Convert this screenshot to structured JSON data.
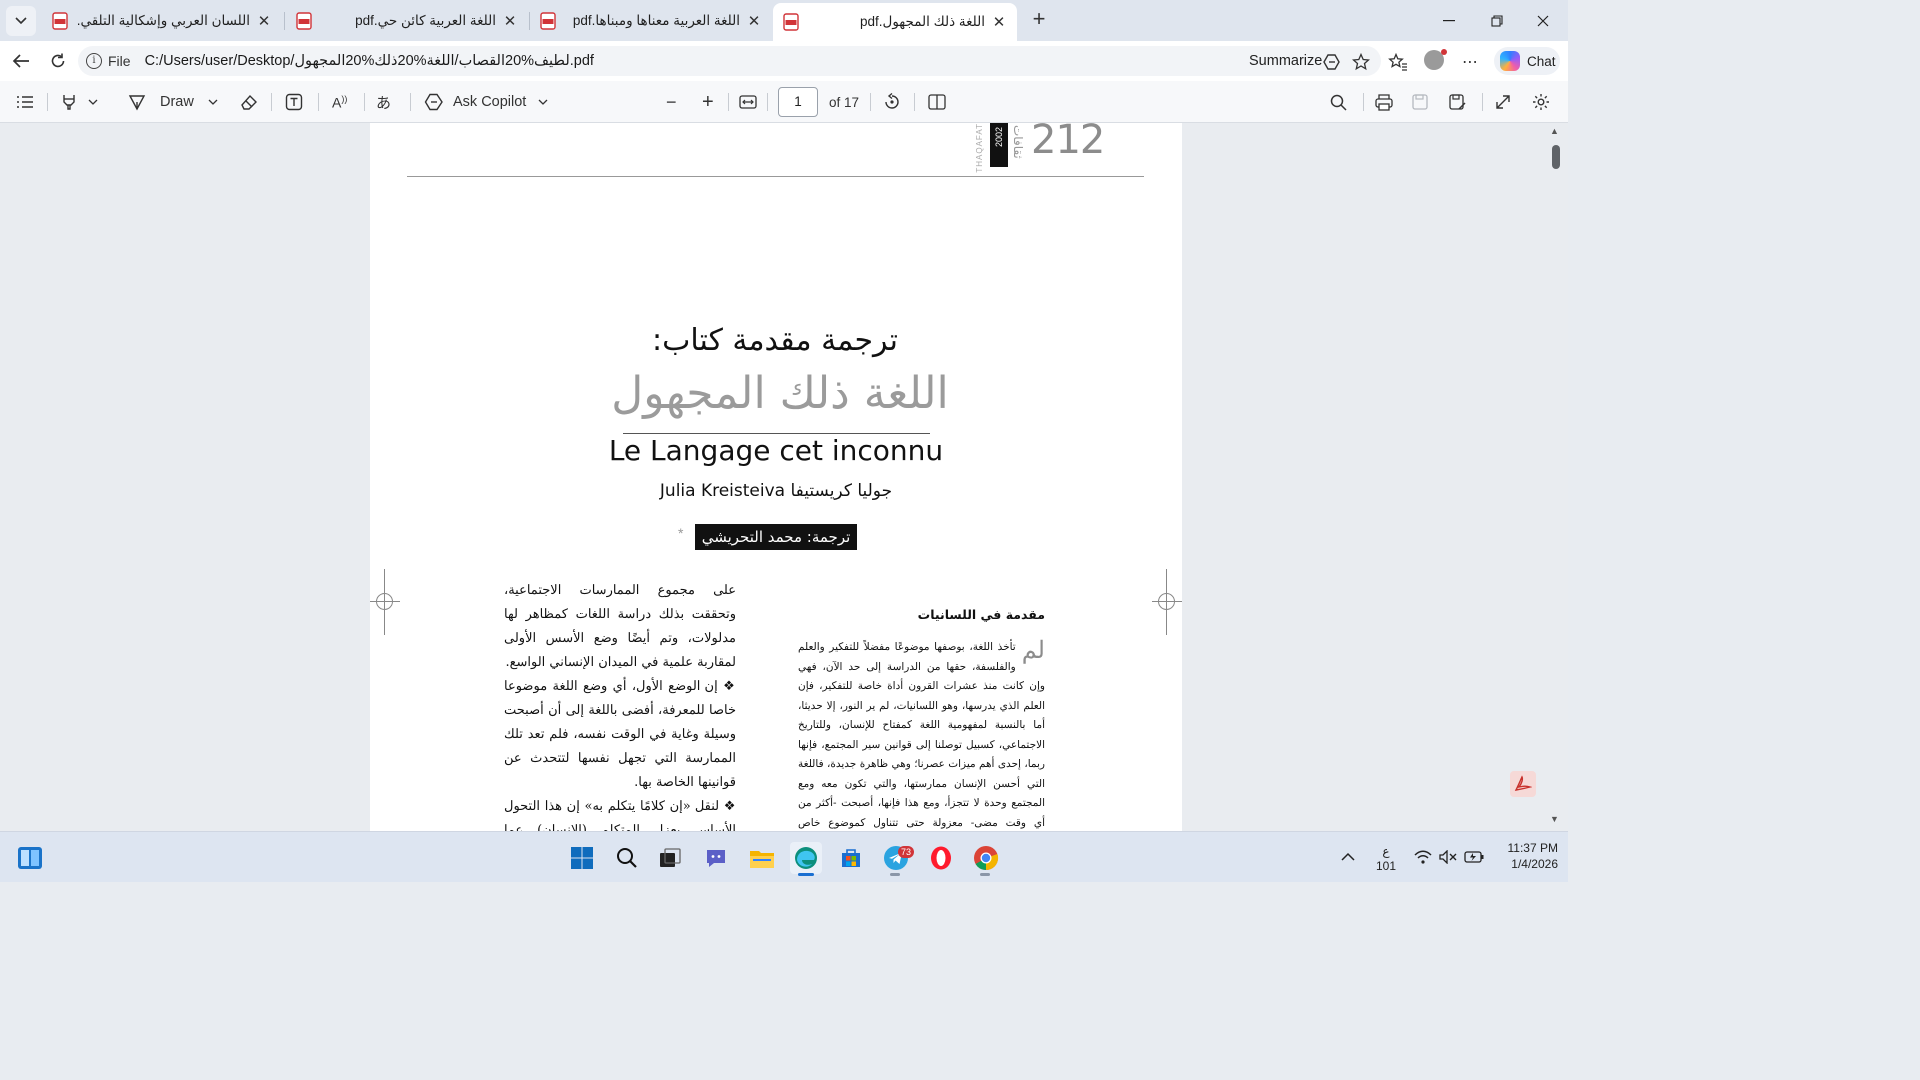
{
  "tabs": [
    {
      "title": "اللسان العربي وإشكالية التلقي.pdf",
      "active": false
    },
    {
      "title": "اللغة العربية كائن حي.pdf",
      "active": false
    },
    {
      "title": "اللغة العربية معناها ومبناها.pdf",
      "active": false
    },
    {
      "title": "اللغة ذلك المجهول.pdf",
      "active": true
    }
  ],
  "address": {
    "scheme": "File",
    "url": "C:/Users/user/Desktop/لطيف%20القصاب/اللغة%20ذلك%20المجهول.pdf",
    "summarize_label": "Summarize",
    "chat_label": "Chat"
  },
  "pdf_toolbar": {
    "draw_label": "Draw",
    "ask_copilot_label": "Ask Copilot",
    "page_current": "1",
    "page_total_label": "of 17"
  },
  "document": {
    "page_number": "212",
    "spine_label": "2002",
    "spine_gray": "THAQAFAT",
    "spine_arabic": "ثقافات",
    "subtitle": "ترجمة مقدمة كتاب:",
    "title_ar": "اللغة ذلك المجهول",
    "title_fr": "Le Langage cet inconnu",
    "author": "Julia Kreisteiva جوليا كريستيفا",
    "translator": "ترجمة: محمد التحريشي",
    "translator_mark": "*",
    "section_heading": "مقدمة في اللسانيات",
    "dropcap": "لم",
    "right_column_text": "تأخذ اللغة، بوصفها موضوعًا مفضلاً للتفكير والعلم والفلسفة، حقها من الدراسة إلى حد الآن، فهي وإن كانت منذ عشرات القرون أداة خاصة للتفكير، فإن العلم الذي يدرسها، وهو اللسانيات، لم ير النور، إلا حديثا، أما بالنسبة لمفهومية اللغة كمفتاح للإنسان، وللتاريخ الاجتماعي، كسبيل توصلنا إلى قوانين سير المجتمع، فإنها ربما، إحدى أهم ميزات عصرنا؛ وهي ظاهرة جديدة، فاللغة التي أحسن الإنسان ممارستها، والتي تكون معه ومع المجتمع وحدة لا تتجزأ، ومع هذا فإنها، أصبحت -أكثر من أي وقت مضى- معزولة حتى تتناول كموضوع خاص للمعرفة يكشف لنا ليس عن قوانين",
    "left_column": [
      {
        "text": "على مجموع الممارسات الاجتماعية، وتحققت بذلك دراسة اللغات كمظاهر لها مدلولات، وتم أيضًا وضع الأسس الأولى لمقاربة علمية في الميدان الإنساني الواسع.",
        "bullet": false
      },
      {
        "text": "إن الوضع الأول، أي وضع اللغة موضوعا خاصا للمعرفة، أفضى باللغة إلى أن أصبحت وسيلة وغاية في الوقت نفسه، فلم تعد تلك الممارسة التي تجهل نفسها لتتحدث عن قوانينها الخاصة بها.",
        "bullet": true
      },
      {
        "text": "لنقل «إن كلامًا يتكلم به» إن هذا التحول الأساس يعزل المتكلم (الإنسان) عما يؤسسه (اللغة)، وفعل",
        "bullet": true
      }
    ]
  },
  "taskbar": {
    "telegram_badge": "73",
    "lang_line1": "ع",
    "lang_line2": "101",
    "time": "11:37 PM",
    "date": "1/4/2026"
  },
  "colors": {
    "tabstrip_bg": "#dfe5ee",
    "pdf_icon_red": "#d13438",
    "title_gray": "#9b9b9b"
  }
}
